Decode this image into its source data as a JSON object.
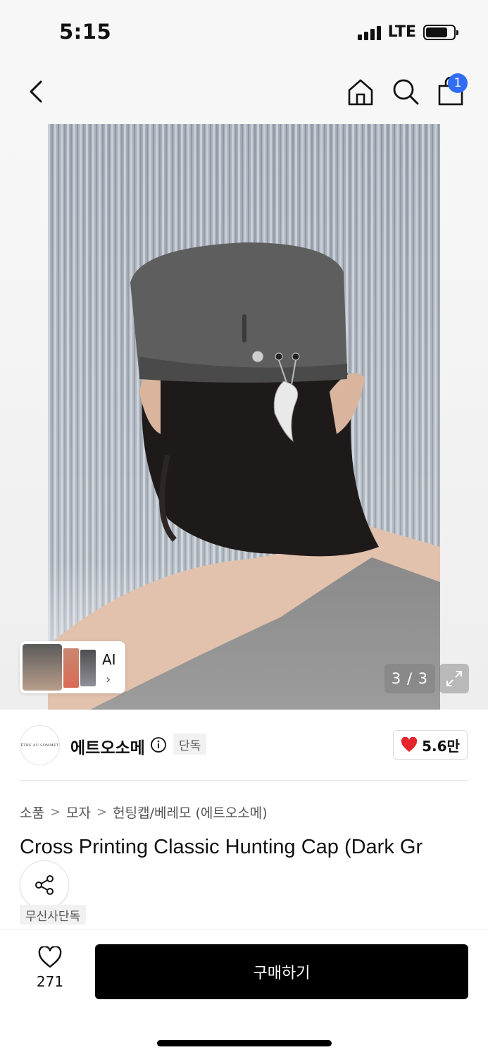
{
  "status_bar": {
    "time": "5:15",
    "network": "LTE"
  },
  "nav": {
    "cart_count": "1"
  },
  "gallery": {
    "page_indicator": "3 / 3",
    "ai_label": "AI"
  },
  "brand": {
    "logo_text": "ÊTRE AU SOMMET",
    "name": "에트오소메",
    "exclusive_badge": "단독",
    "likes": "5.6만"
  },
  "breadcrumb": [
    "소품",
    "모자",
    "헌팅캡/베레모 (에트오소메)"
  ],
  "product": {
    "title": "Cross Printing Classic Hunting Cap (Dark Gr",
    "badge": "무신사단독"
  },
  "bottom": {
    "wish_count": "271",
    "buy_label": "구매하기"
  },
  "colors": {
    "accent": "#2f6df6",
    "heart": "#e5242b",
    "buy_bg": "#000000"
  }
}
